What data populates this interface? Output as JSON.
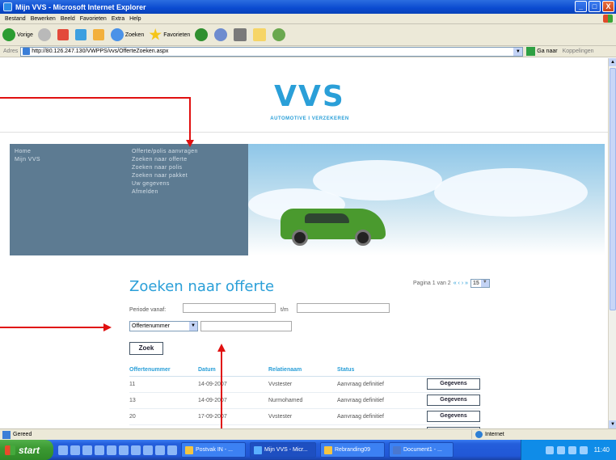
{
  "window": {
    "title": "Mijn VVS - Microsoft Internet Explorer",
    "buttons": [
      "_",
      "□",
      "X"
    ]
  },
  "menu": [
    "Bestand",
    "Bewerken",
    "Beeld",
    "Favorieten",
    "Extra",
    "Help"
  ],
  "toolbar": {
    "back": "Vorige",
    "search": "Zoeken",
    "favorites": "Favorieten"
  },
  "address": {
    "label": "Adres",
    "url": "http://80.126.247.130/VWPPS/vvs/OfferteZoeken.aspx",
    "go": "Ga naar",
    "links": "Koppelingen"
  },
  "site": {
    "logo": "VVS",
    "tagline": "AUTOMOTIVE I VERZEKEREN"
  },
  "nav_left": [
    "Home",
    "Mijn VVS"
  ],
  "nav_mid": [
    "Offerte/polis aanvragen",
    "Zoeken naar offerte",
    "Zoeken naar polis",
    "Zoeken naar pakket",
    "Uw gegevens",
    "Afmelden"
  ],
  "page": {
    "title": "Zoeken naar offerte",
    "pager_label": "Pagina 1 van 2",
    "pager_arrows": "« ‹ › »",
    "page_size": "15"
  },
  "form": {
    "periode_label": "Periode vanaf:",
    "tm_label": "t/m",
    "periode_from": "",
    "periode_to": "",
    "type_select": "Offertenummer",
    "search_value": "",
    "search_button": "Zoek"
  },
  "results": {
    "headers": [
      "Offertenummer",
      "Datum",
      "Relatienaam",
      "Status"
    ],
    "button_label": "Gegevens",
    "rows": [
      {
        "nr": "11",
        "datum": "14-09-2007",
        "relatie": "Vvstester",
        "status": "Aanvraag definitief"
      },
      {
        "nr": "13",
        "datum": "14-09-2007",
        "relatie": "Nurmohamed",
        "status": "Aanvraag definitief"
      },
      {
        "nr": "20",
        "datum": "17-09-2007",
        "relatie": "Vvstester",
        "status": "Aanvraag definitief"
      }
    ]
  },
  "statusbar": {
    "left": "Gereed",
    "zone": "Internet"
  },
  "taskbar": {
    "start": "start",
    "tasks": [
      "Postvak IN - ...",
      "Mijn VVS - Micr...",
      "Rebranding09",
      "Document1 - ..."
    ],
    "clock": "11:40"
  },
  "colors": {
    "accent": "#2a9fd8",
    "nav_bg": "#5d7b92",
    "annotation": "#e01010"
  }
}
